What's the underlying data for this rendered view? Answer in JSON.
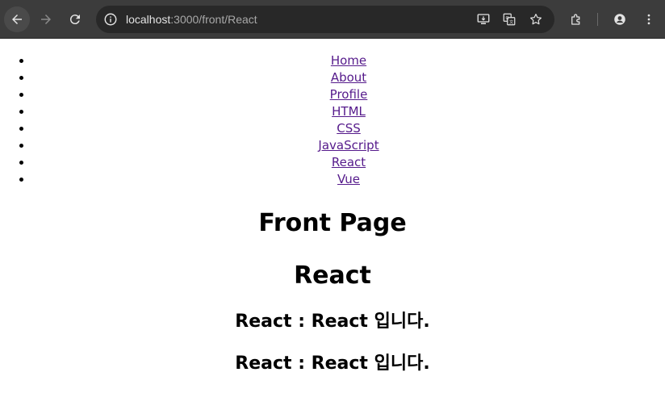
{
  "browser": {
    "url_host": "localhost",
    "url_path": ":3000/front/React"
  },
  "nav": {
    "items": [
      {
        "label": "Home"
      },
      {
        "label": "About"
      },
      {
        "label": "Profile"
      },
      {
        "label": "HTML"
      },
      {
        "label": "CSS"
      },
      {
        "label": "JavaScript"
      },
      {
        "label": "React"
      },
      {
        "label": "Vue"
      }
    ]
  },
  "page": {
    "title": "Front Page",
    "subtitle": "React",
    "lines": [
      "React : React 입니다.",
      "React : React 입니다."
    ]
  },
  "colors": {
    "link_visited": "#551a8b",
    "chrome_bg": "#3c3c3c",
    "omnibox_bg": "#282828"
  }
}
